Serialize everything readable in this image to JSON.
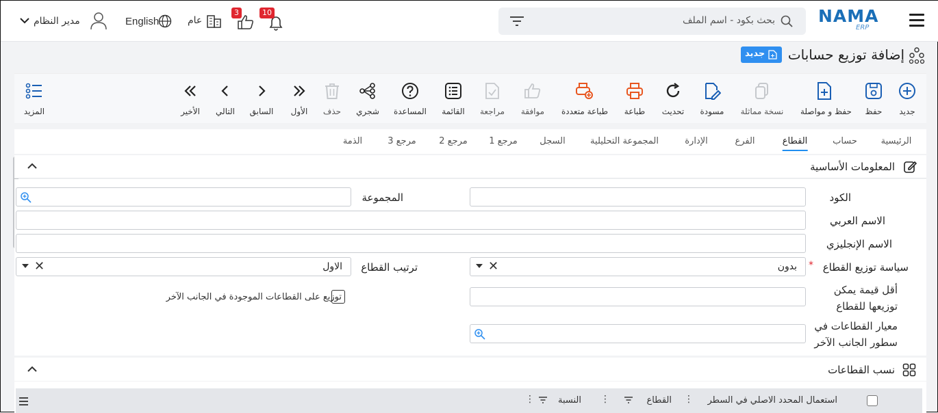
{
  "topbar": {
    "logo_main": "NAMA",
    "logo_sub": "ERP",
    "search_placeholder": "بحث بكود - اسم الملف",
    "notifications_count": "10",
    "likes_count": "3",
    "company_label": "عام",
    "language_label": "English",
    "user_name": "مدير النظام"
  },
  "page": {
    "title": "إضافة توزيع حسابات",
    "new_badge": "جديد"
  },
  "toolbar": {
    "new": "جديد",
    "save": "حفظ",
    "save_continue": "حفظ و مواصلة",
    "duplicate": "نسخة مماثلة",
    "draft": "مسودة",
    "refresh": "تحديث",
    "print": "طباعة",
    "multi_print": "طباعة متعددة",
    "approve": "موافقة",
    "review": "مراجعة",
    "list": "القائمة",
    "help": "المساعدة",
    "tree": "شجري",
    "delete": "حذف",
    "first": "الأول",
    "previous": "السابق",
    "next": "التالي",
    "last": "الأخير",
    "more": "المزيد"
  },
  "tabs": [
    "الرئيسية",
    "حساب",
    "القطاع",
    "الفرع",
    "الإدارة",
    "المجموعة التحليلية",
    "السجل",
    "مرجع 1",
    "مرجع 2",
    "مرجع 3",
    "الذمة"
  ],
  "basic_section": {
    "title": "المعلومات الأساسية",
    "code_label": "الكود",
    "group_label": "المجموعة",
    "arabic_name_label": "الاسم العربي",
    "english_name_label": "الاسم الإنجليزي",
    "policy_label": "سياسة توزيع القطاع",
    "policy_value": "بدون",
    "required_mark": "*",
    "order_label": "ترتيب القطاع",
    "order_value": "الاول",
    "min_value_label_1": "أقل قيمة يمكن",
    "min_value_label_2": "توزيعها للقطاع",
    "distribute_checkbox_label": "توزيع على القطاعات الموجودة في الجانب الآخر",
    "criteria_label_1": "معيار القطاعات في",
    "criteria_label_2": "سطور الجانب الآخر"
  },
  "ratios_section": {
    "title": "نسب القطاعات",
    "columns": [
      "استعمال المحدد الاصلي في السطر",
      "القطاع",
      "النسبة"
    ]
  }
}
